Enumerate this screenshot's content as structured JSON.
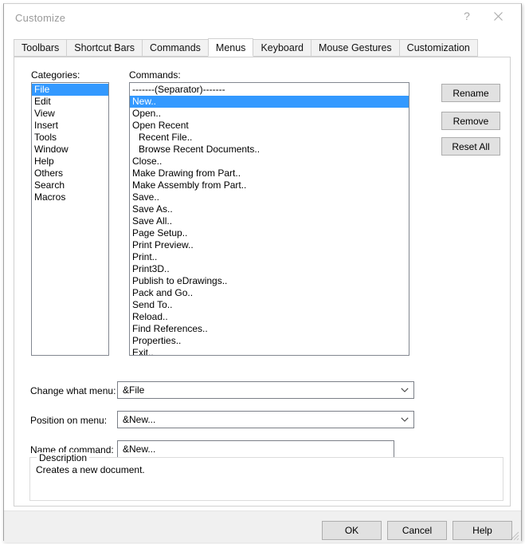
{
  "window": {
    "title": "Customize",
    "help_icon": "question-mark-icon",
    "close_icon": "close-icon"
  },
  "tabs": [
    {
      "label": "Toolbars",
      "active": false
    },
    {
      "label": "Shortcut Bars",
      "active": false
    },
    {
      "label": "Commands",
      "active": false
    },
    {
      "label": "Menus",
      "active": true
    },
    {
      "label": "Keyboard",
      "active": false
    },
    {
      "label": "Mouse Gestures",
      "active": false
    },
    {
      "label": "Customization",
      "active": false
    }
  ],
  "categories": {
    "label": "Categories:",
    "selected": "File",
    "items": [
      "File",
      "Edit",
      "View",
      "Insert",
      "Tools",
      "Window",
      "Help",
      "Others",
      "Search",
      "Macros"
    ]
  },
  "commands": {
    "label": "Commands:",
    "selected": "New..",
    "items": [
      {
        "text": "-------(Separator)-------",
        "indent": false,
        "selected": false
      },
      {
        "text": "New..",
        "indent": false,
        "selected": true
      },
      {
        "text": "Open..",
        "indent": false,
        "selected": false
      },
      {
        "text": "Open Recent",
        "indent": false,
        "selected": false
      },
      {
        "text": "Recent File..",
        "indent": true,
        "selected": false
      },
      {
        "text": "Browse Recent Documents..",
        "indent": true,
        "selected": false
      },
      {
        "text": "Close..",
        "indent": false,
        "selected": false
      },
      {
        "text": "Make Drawing from Part..",
        "indent": false,
        "selected": false
      },
      {
        "text": "Make Assembly from Part..",
        "indent": false,
        "selected": false
      },
      {
        "text": "Save..",
        "indent": false,
        "selected": false
      },
      {
        "text": "Save As..",
        "indent": false,
        "selected": false
      },
      {
        "text": "Save All..",
        "indent": false,
        "selected": false
      },
      {
        "text": "Page Setup..",
        "indent": false,
        "selected": false
      },
      {
        "text": "Print Preview..",
        "indent": false,
        "selected": false
      },
      {
        "text": "Print..",
        "indent": false,
        "selected": false
      },
      {
        "text": "Print3D..",
        "indent": false,
        "selected": false
      },
      {
        "text": "Publish to eDrawings..",
        "indent": false,
        "selected": false
      },
      {
        "text": "Pack and Go..",
        "indent": false,
        "selected": false
      },
      {
        "text": "Send To..",
        "indent": false,
        "selected": false
      },
      {
        "text": "Reload..",
        "indent": false,
        "selected": false
      },
      {
        "text": "Find References..",
        "indent": false,
        "selected": false
      },
      {
        "text": "Properties..",
        "indent": false,
        "selected": false
      },
      {
        "text": "Exit..",
        "indent": false,
        "selected": false
      }
    ]
  },
  "side_buttons": {
    "rename": "Rename",
    "remove": "Remove",
    "reset_all": "Reset All"
  },
  "form": {
    "change_what_menu": {
      "label": "Change what menu:",
      "value": "&File"
    },
    "position_on_menu": {
      "label": "Position on menu:",
      "value": "&New..."
    },
    "name_of_command": {
      "label": "Name of command:",
      "value": "&New..."
    }
  },
  "description": {
    "title": "Description",
    "text": "Creates a new document."
  },
  "footer": {
    "ok": "OK",
    "cancel": "Cancel",
    "help": "Help"
  },
  "colors": {
    "selection_blue": "#3399ff",
    "window_bg": "#ffffff",
    "footer_bg": "#f0f0f0",
    "tab_inactive": "#f2f2f2",
    "button_face": "#e1e1e1",
    "border": "#d0d0d0"
  }
}
